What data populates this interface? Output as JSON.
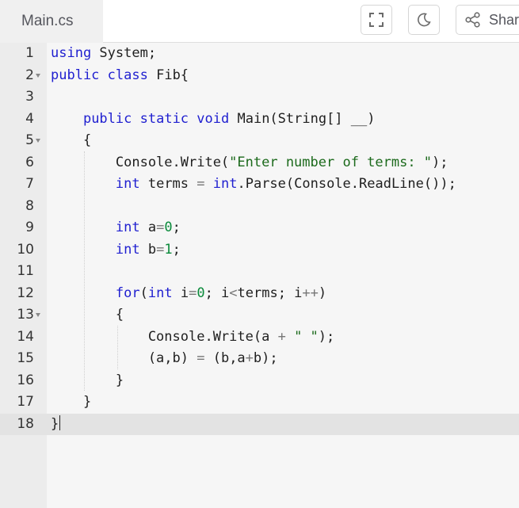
{
  "tab": {
    "filename": "Main.cs"
  },
  "toolbar": {
    "share_label": "Share"
  },
  "editor": {
    "active_line": "18",
    "lines": [
      {
        "num": "1",
        "code": "using System;"
      },
      {
        "num": "2",
        "code": "public class Fib{"
      },
      {
        "num": "3",
        "code": ""
      },
      {
        "num": "4",
        "code": "    public static void Main(String[] __)"
      },
      {
        "num": "5",
        "code": "    {"
      },
      {
        "num": "6",
        "code": "        Console.Write(\"Enter number of terms: \");"
      },
      {
        "num": "7",
        "code": "        int terms = int.Parse(Console.ReadLine());"
      },
      {
        "num": "8",
        "code": ""
      },
      {
        "num": "9",
        "code": "        int a=0;"
      },
      {
        "num": "10",
        "code": "        int b=1;"
      },
      {
        "num": "11",
        "code": ""
      },
      {
        "num": "12",
        "code": "        for(int i=0; i<terms; i++)"
      },
      {
        "num": "13",
        "code": "        {"
      },
      {
        "num": "14",
        "code": "            Console.Write(a + \" \");"
      },
      {
        "num": "15",
        "code": "            (a,b) = (b,a+b);"
      },
      {
        "num": "16",
        "code": "        }"
      },
      {
        "num": "17",
        "code": "    }"
      },
      {
        "num": "18",
        "code": "}"
      }
    ]
  },
  "icons": {
    "fullscreen": "fullscreen-icon",
    "theme": "moon-icon",
    "share": "share-icon"
  }
}
